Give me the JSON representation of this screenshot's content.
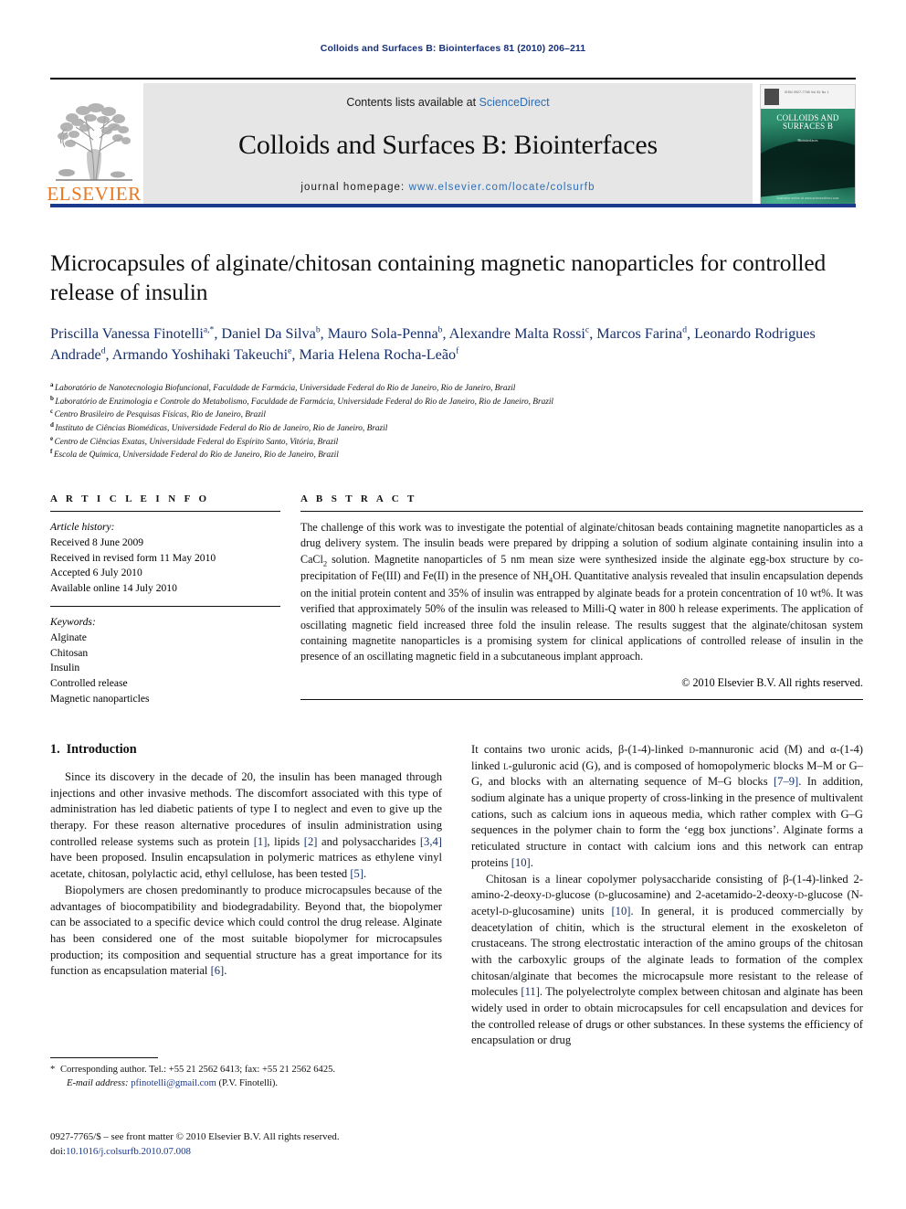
{
  "running_head": "Colloids and Surfaces B: Biointerfaces 81 (2010) 206–211",
  "masthead": {
    "publisher_name": "ELSEVIER",
    "contents_prefix": "Contents lists available at ",
    "contents_link": "ScienceDirect",
    "journal_title": "Colloids and Surfaces B: Biointerfaces",
    "homepage_prefix": "journal homepage: ",
    "homepage_url": "www.elsevier.com/locate/colsurfb",
    "link_color": "#2e6db4",
    "band_color": "#e6e6e6",
    "rule_color": "#1b3a8c",
    "cover": {
      "issn_line": "ISSN 0927-7765     Vol 81 No 1",
      "title_line1": "COLLOIDS AND",
      "title_line2": "SURFACES B",
      "subtitle": "Biointerfaces",
      "bottom_line": "Available online at www.sciencedirect.com"
    }
  },
  "article": {
    "title": "Microcapsules of alginate/chitosan containing magnetic nanoparticles for controlled release of insulin",
    "authors_line1_parts": [
      {
        "name": "Priscilla Vanessa Finotelli",
        "sup": "a,*"
      },
      {
        "name": "Daniel Da Silva",
        "sup": "b"
      },
      {
        "name": "Mauro Sola-Penna",
        "sup": "b"
      },
      {
        "name": "Alexandre Malta Rossi",
        "sup": "c"
      }
    ],
    "authors_line2_parts": [
      {
        "name": "Marcos Farina",
        "sup": "d"
      },
      {
        "name": "Leonardo Rodrigues Andrade",
        "sup": "d"
      },
      {
        "name": "Armando Yoshihaki Takeuchi",
        "sup": "e"
      },
      {
        "name": "Maria Helena Rocha-Leão",
        "sup": "f"
      }
    ],
    "affiliations": [
      {
        "mark": "a",
        "text": "Laboratório de Nanotecnologia Biofuncional, Faculdade de Farmácia, Universidade Federal do Rio de Janeiro, Rio de Janeiro, Brazil"
      },
      {
        "mark": "b",
        "text": "Laboratório de Enzimologia e Controle do Metabolismo, Faculdade de Farmácia, Universidade Federal do Rio de Janeiro, Rio de Janeiro, Brazil"
      },
      {
        "mark": "c",
        "text": "Centro Brasileiro de Pesquisas Físicas, Rio de Janeiro, Brazil"
      },
      {
        "mark": "d",
        "text": "Instituto de Ciências Biomédicas, Universidade Federal do Rio de Janeiro, Rio de Janeiro, Brazil"
      },
      {
        "mark": "e",
        "text": "Centro de Ciências Exatas, Universidade Federal do Espírito Santo, Vitória, Brazil"
      },
      {
        "mark": "f",
        "text": "Escola de Química, Universidade Federal do Rio de Janeiro, Rio de Janeiro, Brazil"
      }
    ]
  },
  "article_info": {
    "heading": "A R T I C L E   I N F O",
    "history_title": "Article history:",
    "history": [
      "Received 8 June 2009",
      "Received in revised form 11 May 2010",
      "Accepted 6 July 2010",
      "Available online 14 July 2010"
    ],
    "keywords_title": "Keywords:",
    "keywords": [
      "Alginate",
      "Chitosan",
      "Insulin",
      "Controlled release",
      "Magnetic nanoparticles"
    ]
  },
  "abstract": {
    "heading": "A B S T R A C T",
    "paragraph_1": "The challenge of this work was to investigate the potential of alginate/chitosan beads containing magnetite nanoparticles as a drug delivery system. The insulin beads were prepared by dripping a solution of sodium alginate containing insulin into a CaCl",
    "sub_1": "2",
    "paragraph_2": " solution. Magnetite nanoparticles of 5 nm mean size were synthesized inside the alginate egg-box structure by co-precipitation of Fe(III) and Fe(II) in the presence of NH",
    "sub_2": "4",
    "paragraph_3": "OH. Quantitative analysis revealed that insulin encapsulation depends on the initial protein content and 35% of insulin was entrapped by alginate beads for a protein concentration of 10 wt%. It was verified that approximately 50% of the insulin was released to Milli-Q water in 800 h release experiments. The application of oscillating magnetic field increased three fold the insulin release. The results suggest that the alginate/chitosan system containing magnetite nanoparticles is a promising system for clinical applications of controlled release of insulin in the presence of an oscillating magnetic field in a subcutaneous implant approach.",
    "copyright": "© 2010 Elsevier B.V. All rights reserved."
  },
  "sections": {
    "intro_number": "1.",
    "intro_title": "Introduction"
  },
  "body": {
    "left_p1_a": "Since its discovery in the decade of 20, the insulin has been managed through injections and other invasive methods. The discomfort associated with this type of administration has led diabetic patients of type I to neglect and even to give up the therapy. For these reason alternative procedures of insulin administration using controlled release systems such as protein ",
    "left_p1_r1": "[1]",
    "left_p1_b": ", lipids ",
    "left_p1_r2": "[2]",
    "left_p1_c": " and polysaccharides ",
    "left_p1_r3": "[3,4]",
    "left_p1_d": " have been proposed. Insulin encapsulation in polymeric matrices as ethylene vinyl acetate, chitosan, polylactic acid, ethyl cellulose, has been tested ",
    "left_p1_r4": "[5]",
    "left_p1_e": ".",
    "left_p2_a": "Biopolymers are chosen predominantly to produce microcapsules because of the advantages of biocompatibility and biodegradability. Beyond that, the biopolymer can be associated to a specific device which could control the drug release. Alginate has been considered one of the most suitable biopolymer for microcapsules production; its composition and sequential structure has a great importance for its function as encapsulation material ",
    "left_p2_r1": "[6]",
    "left_p2_b": ".",
    "right_p1_a": "It contains two uronic acids, β-(1-4)-linked ",
    "right_p1_sc1": "d",
    "right_p1_b": "-mannuronic acid (M) and α-(1-4) linked ",
    "right_p1_sc2": "l",
    "right_p1_c": "-guluronic acid (G), and is composed of homopolymeric blocks M–M or G–G, and blocks with an alternating sequence of M–G blocks ",
    "right_p1_r1": "[7–9]",
    "right_p1_d": ". In addition, sodium alginate has a unique property of cross-linking in the presence of multivalent cations, such as calcium ions in aqueous media, which rather complex with G–G sequences in the polymer chain to form the ‘egg box junctions’. Alginate forms a reticulated structure in contact with calcium ions and this network can entrap proteins ",
    "right_p1_r2": "[10]",
    "right_p1_e": ".",
    "right_p2_a": "Chitosan is a linear copolymer polysaccharide consisting of β-(1-4)-linked 2-amino-2-deoxy-",
    "right_p2_sc1": "d",
    "right_p2_b": "-glucose (",
    "right_p2_sc2": "d",
    "right_p2_c": "-glucosamine) and 2-acetamido-2-deoxy-",
    "right_p2_sc3": "d",
    "right_p2_d": "-glucose (N-acetyl-",
    "right_p2_sc4": "d",
    "right_p2_e": "-glucosamine) units ",
    "right_p2_r1": "[10]",
    "right_p2_f": ". In general, it is produced commercially by deacetylation of chitin, which is the structural element in the exoskeleton of crustaceans. The strong electrostatic interaction of the amino groups of the chitosan with the carboxylic groups of the alginate leads to formation of the complex chitosan/alginate that becomes the microcapsule more resistant to the release of molecules ",
    "right_p2_r2": "[11]",
    "right_p2_g": ". The polyelectrolyte complex between chitosan and alginate has been widely used in order to obtain microcapsules for cell encapsulation and devices for the controlled release of drugs or other substances. In these systems the efficiency of encapsulation or drug"
  },
  "footer": {
    "corresponding_star": "*",
    "corresponding_text": " Corresponding author. Tel.: +55 21 2562 6413; fax: +55 21 2562 6425.",
    "email_label": "E-mail address:",
    "email": "pfinotelli@gmail.com",
    "email_owner": " (P.V. Finotelli).",
    "imprint_line": "0927-7765/$ – see front matter © 2010 Elsevier B.V. All rights reserved.",
    "doi_prefix": "doi:",
    "doi": "10.1016/j.colsurfb.2010.07.008"
  }
}
